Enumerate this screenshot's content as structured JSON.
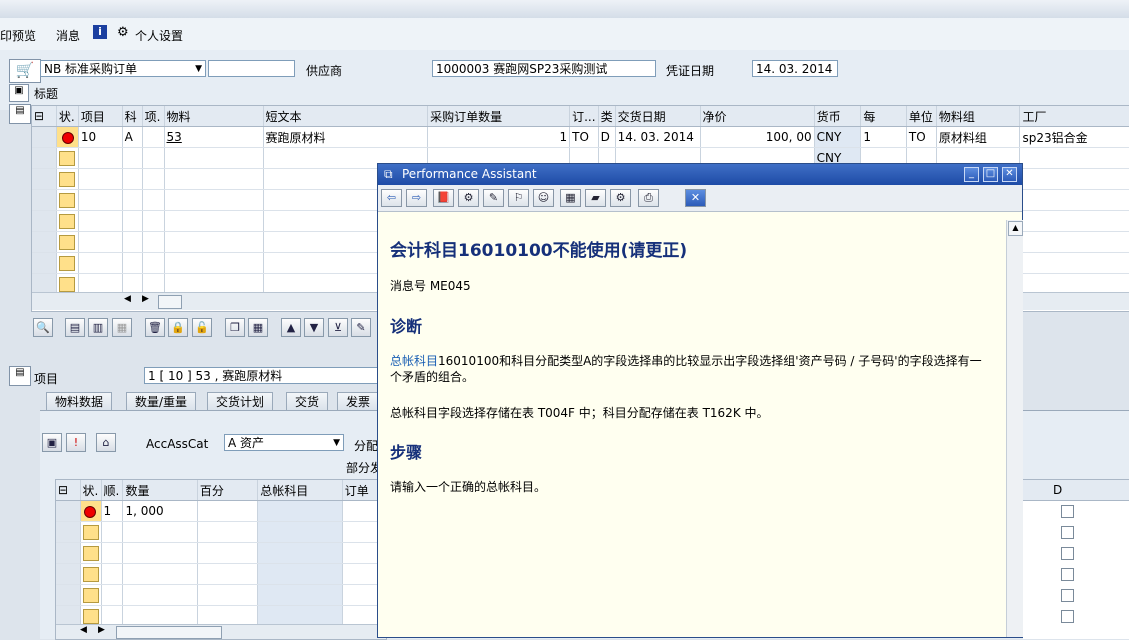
{
  "menu": {
    "print_preview": "印预览",
    "messages": "消息",
    "personal_settings": "个人设置"
  },
  "header": {
    "doc_type": "NB 标准采购订单",
    "doc_number": "",
    "vendor_label": "供应商",
    "vendor_value": "1000003 赛跑网SP23采购测试",
    "doc_date_label": "凭证日期",
    "doc_date_value": "14. 03. 2014",
    "title_label": "标题"
  },
  "items_table": {
    "headers": [
      "状.",
      "项目",
      "科",
      "项.",
      "物料",
      "短文本",
      "采购订单数量",
      "订...",
      "类",
      "交货日期",
      "净价",
      "货币",
      "每",
      "单位",
      "物料组",
      "工厂"
    ],
    "row1": {
      "item": "10",
      "acc": "A",
      "cat": "",
      "material": "53",
      "short_text": "赛跑原材料",
      "qty": "1",
      "oun": "TO",
      "type": "D",
      "delivery_date": "14. 03. 2014",
      "net_price": "100, 00",
      "currency": "CNY",
      "per": "1",
      "unit": "TO",
      "mat_group": "原材料组",
      "plant": "sp23铝合金"
    },
    "row2": {
      "currency": "CNY"
    }
  },
  "item_detail": {
    "label": "项目",
    "select_value": "1 [ 10 ] 53 , 赛跑原材料",
    "tabs": [
      "物料数据",
      "数量/重量",
      "交货计划",
      "交货",
      "发票"
    ],
    "acc_ass_cat_label": "AccAssCat",
    "acc_ass_cat_value": "A 资产",
    "distribution_label": "分配",
    "partial_label": "部分发"
  },
  "account_table": {
    "headers": [
      "状.",
      "顺.",
      "数量",
      "百分",
      "总帐科目",
      "订单"
    ],
    "row1": {
      "seq": "1",
      "qty": "1, 000"
    },
    "d_header": "D"
  },
  "popup": {
    "title": "Performance Assistant",
    "heading": "会计科目16010100不能使用(请更正)",
    "message_no": "消息号  ME045",
    "diag_heading": "诊断",
    "diag_link": "总帐科目",
    "diag_text": "16010100和科目分配类型A的字段选择串的比较显示出字段选择组'资产号码  / 子号码'的字段选择有一个矛盾的组合。",
    "diag_text2": "总帐科目字段选择存储在表  T004F 中；科目分配存储在表  T162K 中。",
    "steps_heading": "步骤",
    "steps_text": "请输入一个正确的总帐科目。"
  },
  "colors": {
    "titlebar": "#1e4ba6",
    "popup_bg": "#fffff0",
    "heading": "#16307a",
    "link": "#1a5fb4"
  }
}
